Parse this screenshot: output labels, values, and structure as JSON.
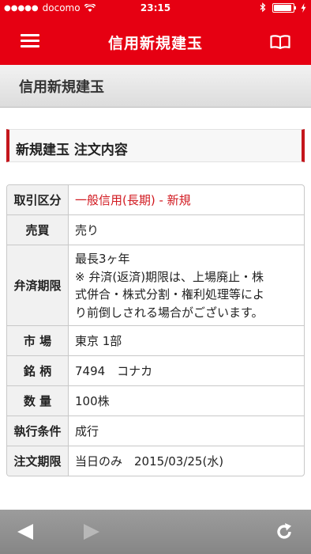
{
  "status_bar": {
    "carrier_dots": "●●●●●",
    "carrier": "docomo",
    "time": "23:15",
    "battery_level": 0.9
  },
  "nav": {
    "title": "信用新規建玉",
    "menu_icon": "hamburger-menu-icon",
    "book_icon": "open-book-icon"
  },
  "page_header": {
    "title": "信用新規建玉"
  },
  "section": {
    "title": "新規建玉 注文内容"
  },
  "order": {
    "rows": [
      {
        "label": "取引区分",
        "value": "一般信用(長期) - 新規",
        "highlight_color": "#d1181f"
      },
      {
        "label": "売買",
        "value": "売り"
      },
      {
        "label": "弁済期限",
        "lines": [
          "最長3ヶ年",
          "※ 弁済(返済)期限は、上場廃止・株",
          "式併合・株式分割・権利処理等によ",
          "り前倒しされる場合がございます。"
        ]
      },
      {
        "label": "市 場",
        "value": "東京 1部"
      },
      {
        "label": "銘 柄",
        "value": "7494　コナカ"
      },
      {
        "label": "数 量",
        "value": "100株"
      },
      {
        "label": "執行条件",
        "value": "成行"
      },
      {
        "label": "注文期限",
        "value": "当日のみ　2015/03/25(水)"
      }
    ]
  },
  "toolbar": {
    "back_icon": "back-arrow-icon",
    "forward_icon": "forward-arrow-icon",
    "reload_icon": "reload-icon"
  },
  "colors": {
    "accent": "#e60012",
    "section_bar": "#c4161c"
  }
}
